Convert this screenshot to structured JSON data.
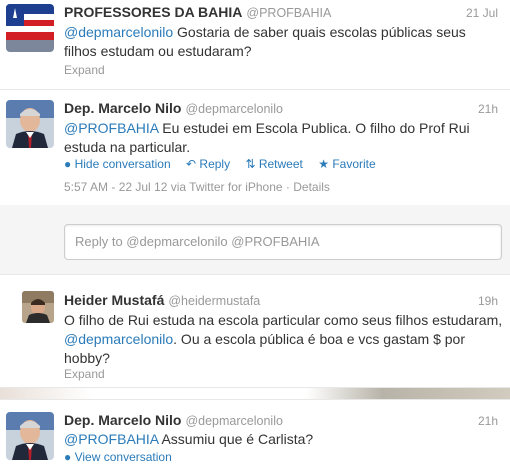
{
  "tweets": [
    {
      "name": "PROFESSORES DA BAHIA",
      "handle": "@PROFBAHIA",
      "time": "21 Jul",
      "mention": "@depmarcelonilo",
      "text": " Gostaria de saber quais escolas públicas seus filhos estudam ou estudaram?",
      "expand": "Expand"
    },
    {
      "name": "Dep. Marcelo Nilo",
      "handle": "@depmarcelonilo",
      "time": "21h",
      "mention": "@PROFBAHIA",
      "text": " Eu estudei em Escola Publica. O filho do Prof Rui estuda na particular.",
      "actions": {
        "hide": "Hide conversation",
        "reply": "Reply",
        "retweet": "Retweet",
        "favorite": "Favorite"
      },
      "meta": "5:57 AM - 22 Jul 12 via Twitter for iPhone · Details"
    },
    {
      "name": "Heider Mustafá",
      "handle": "@heidermustafa",
      "time": "19h",
      "text_a": "O filho de Rui estuda na escola particular como seus filhos estudaram, ",
      "mention": "@depmarcelonilo",
      "text_b": ". Ou a escola pública é boa e vcs gastam $ por hobby?",
      "expand": "Expand"
    },
    {
      "name": "Dep. Marcelo Nilo",
      "handle": "@depmarcelonilo",
      "time": "21h",
      "mention": "@PROFBAHIA",
      "text": " Assumiu que é Carlista?",
      "view": "View conversation"
    }
  ],
  "reply": {
    "placeholder": "Reply to @depmarcelonilo @PROFBAHIA"
  },
  "colors": {
    "link": "#2b7bb9",
    "muted": "#999999",
    "text": "#333333"
  }
}
